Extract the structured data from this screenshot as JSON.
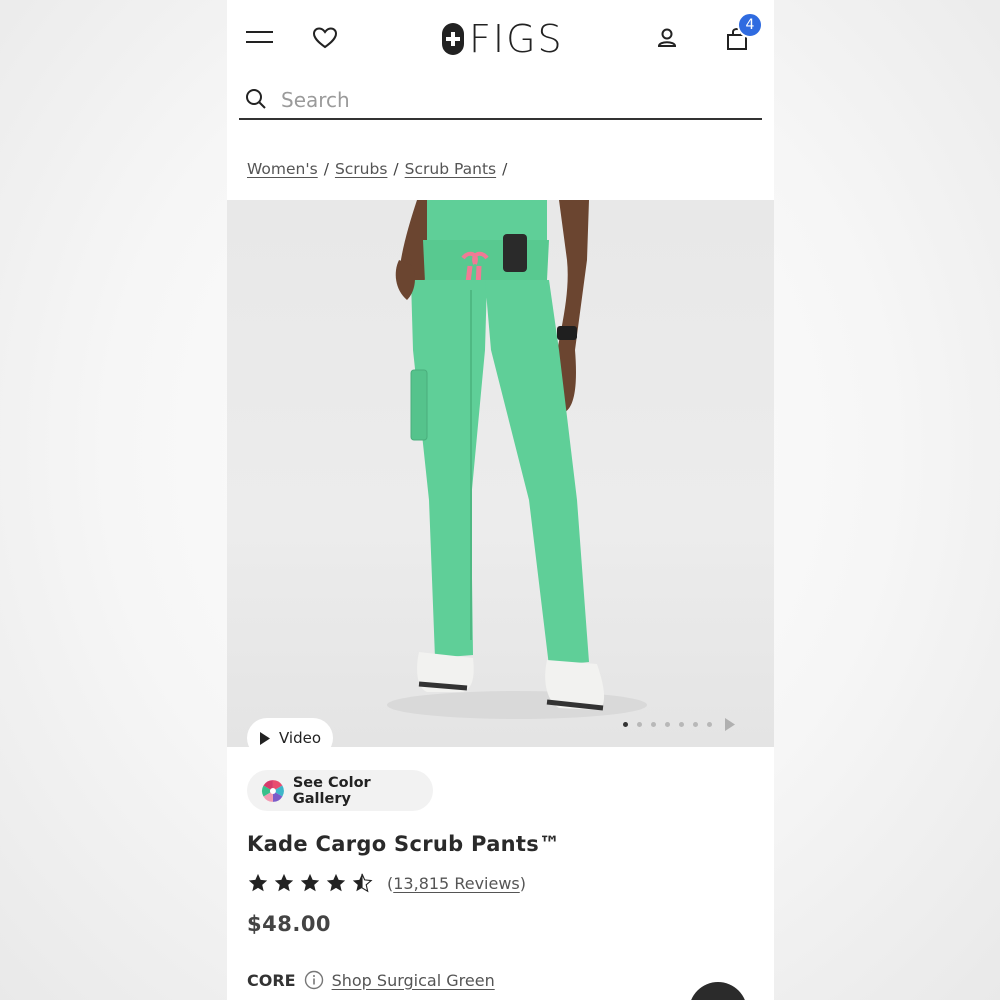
{
  "header": {
    "logo_text": "FIGS",
    "cart_count": "4"
  },
  "search": {
    "placeholder": "Search"
  },
  "breadcrumb": {
    "items": [
      "Women's",
      "Scrubs",
      "Scrub Pants"
    ],
    "separator": "/"
  },
  "hero": {
    "video_label": "Video",
    "carousel_total": 8,
    "carousel_active": 1
  },
  "colors": {
    "accent": "#2f6be0",
    "product_color": "#5fcf98"
  },
  "product": {
    "gallery_label": "See Color Gallery",
    "title": "Kade Cargo Scrub Pants™",
    "rating": 4.5,
    "reviews_open": "(",
    "reviews_count": "13,815 Reviews",
    "reviews_close": ")",
    "price": "$48.00",
    "collection": "CORE",
    "shop_color_link": "Shop Surgical Green"
  }
}
